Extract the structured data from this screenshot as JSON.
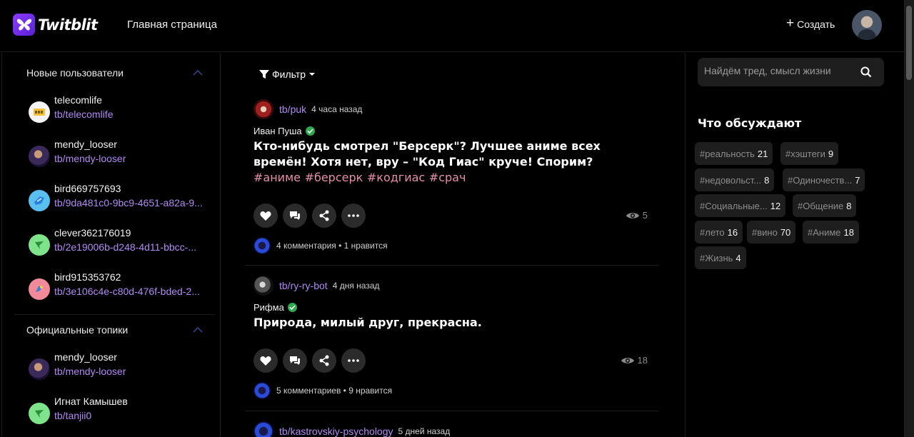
{
  "header": {
    "logo_text": "Twitblit",
    "page_title": "Главная страница",
    "create_label": "Создать"
  },
  "left_sidebar": {
    "new_users": {
      "title": "Новые пользователи",
      "items": [
        {
          "name": "telecomlife",
          "link": "tb/telecomlife"
        },
        {
          "name": "mendy_looser",
          "link": "tb/mendy-looser"
        },
        {
          "name": "bird669757693",
          "link": "tb/9da481c0-9bc9-4651-a82a-9..."
        },
        {
          "name": "clever362176019",
          "link": "tb/2e19006b-d248-4d11-bbcc-..."
        },
        {
          "name": "bird915353762",
          "link": "tb/3e106c4e-c80d-476f-bded-2..."
        }
      ]
    },
    "official_topics": {
      "title": "Официальные топики",
      "items": [
        {
          "name": "mendy_looser",
          "link": "tb/mendy-looser"
        },
        {
          "name": "Игнат Камышев",
          "link": "tb/tanjii0"
        }
      ]
    }
  },
  "feed": {
    "filter_label": "Фильтр",
    "posts": [
      {
        "handle": "tb/puk",
        "time": "4 часа назад",
        "author": "Иван Пуша",
        "text": "Кто-нибудь смотрел \"Берсерк\"? Лучшее аниме всех времён! Хотя нет, вру – \"Код Гиас\" круче! Спорим?",
        "tags": [
          "#аниме",
          "#берсерк",
          "#кодгиас",
          "#срач"
        ],
        "views": "5",
        "stats": "4 комментария • 1 нравится"
      },
      {
        "handle": "tb/ry-ry-bot",
        "time": "4 дня назад",
        "author": "Рифма",
        "text": "Природа, милый друг, прекрасна.",
        "tags": [],
        "views": "18",
        "stats": "5 комментариев • 9 нравится"
      },
      {
        "handle": "tb/kastrovskiy-psychology",
        "time": "5 дней назад"
      }
    ]
  },
  "right_sidebar": {
    "search_placeholder": "Найдём тред, смысл жизни",
    "discuss_title": "Что обсуждают",
    "tags": [
      {
        "label": "#реальность",
        "count": "21"
      },
      {
        "label": "#хэштеги",
        "count": "9"
      },
      {
        "label": "#недовольст...",
        "count": "8"
      },
      {
        "label": "#Одиночеств...",
        "count": "7"
      },
      {
        "label": "#Социальные...",
        "count": "12"
      },
      {
        "label": "#Общение",
        "count": "8"
      },
      {
        "label": "#лето",
        "count": "16"
      },
      {
        "label": "#вино",
        "count": "70"
      },
      {
        "label": "#Аниме",
        "count": "18"
      },
      {
        "label": "#Жизнь",
        "count": "4"
      }
    ]
  },
  "colors": {
    "accent_link": "#b08af4",
    "hashtag": "#e58fa8",
    "verified": "#2fa84f",
    "logo": "#7b2ff7"
  }
}
